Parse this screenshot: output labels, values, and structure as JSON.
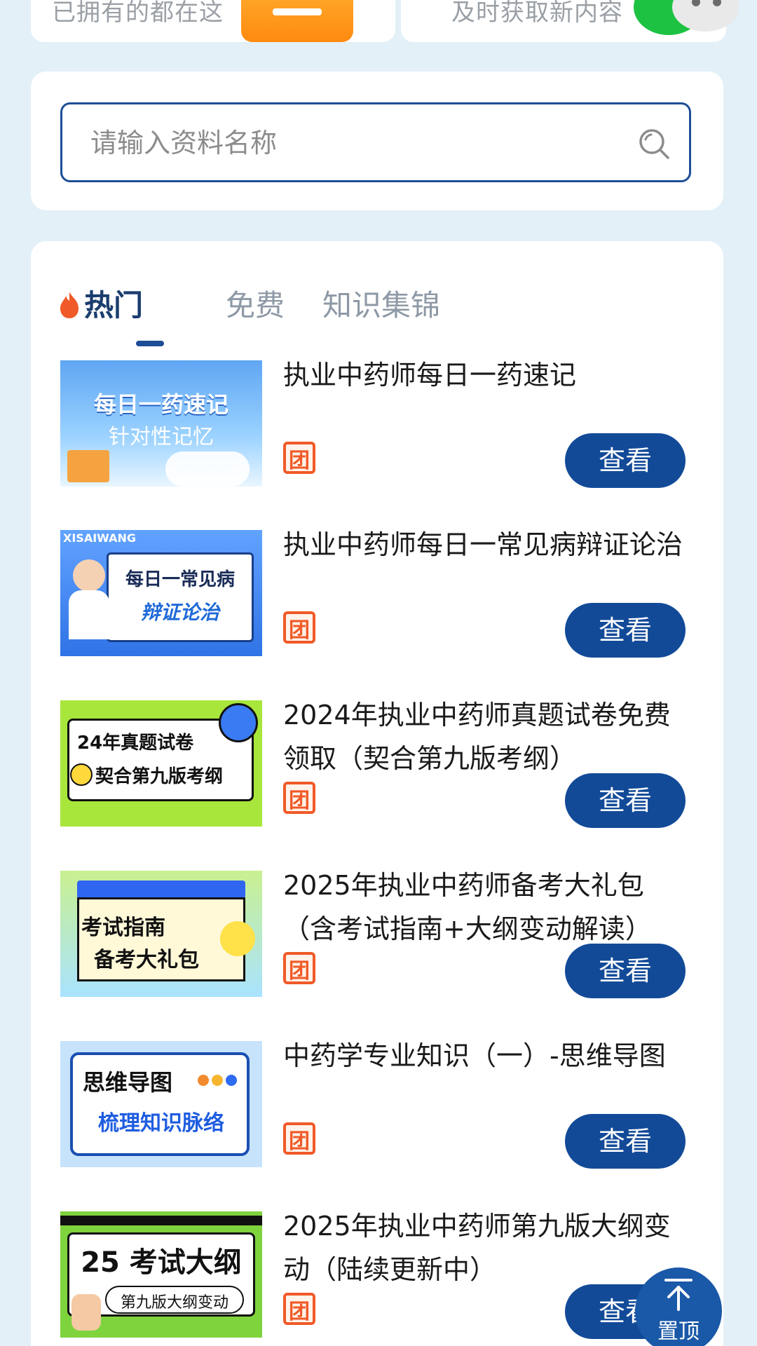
{
  "top_cards": {
    "left_text": "已拥有的都在这",
    "right_text": "及时获取新内容"
  },
  "search": {
    "placeholder": "请输入资料名称"
  },
  "tabs": [
    {
      "label": "热门",
      "active": true
    },
    {
      "label": "免费",
      "active": false
    },
    {
      "label": "知识集锦",
      "active": false
    }
  ],
  "items": [
    {
      "title": "执业中药师每日一药速记",
      "thumb_line1": "每日一药速记",
      "thumb_line2": "针对性记忆",
      "button": "查看",
      "badge": "团"
    },
    {
      "title": "执业中药师每日一常见病辩证论治",
      "thumb_line1": "每日一常见病",
      "thumb_line2": "辩证论治",
      "thumb_top": "XISAIWANG",
      "button": "查看",
      "badge": "团"
    },
    {
      "title": "2024年执业中药师真题试卷免费领取（契合第九版考纲）",
      "thumb_line1": "24年真题试卷",
      "thumb_line2": "契合第九版考纲",
      "button": "查看",
      "badge": "团"
    },
    {
      "title": "2025年执业中药师备考大礼包（含考试指南+大纲变动解读）",
      "thumb_line1": "考试指南",
      "thumb_line2": "备考大礼包",
      "button": "查看",
      "badge": "团"
    },
    {
      "title": "中药学专业知识（一）-思维导图",
      "thumb_line1": "思维导图",
      "thumb_line2": "梳理知识脉络",
      "button": "查看",
      "badge": "团"
    },
    {
      "title": "2025年执业中药师第九版大纲变动（陆续更新中）",
      "thumb_line1": "25 考试大纲",
      "thumb_line2": "第九版大纲变动",
      "button": "查看",
      "badge": "团"
    }
  ],
  "back_to_top": {
    "label": "置顶"
  },
  "colors": {
    "primary": "#124a98",
    "accent_orange": "#f05a28",
    "background": "#e3f0f7"
  }
}
